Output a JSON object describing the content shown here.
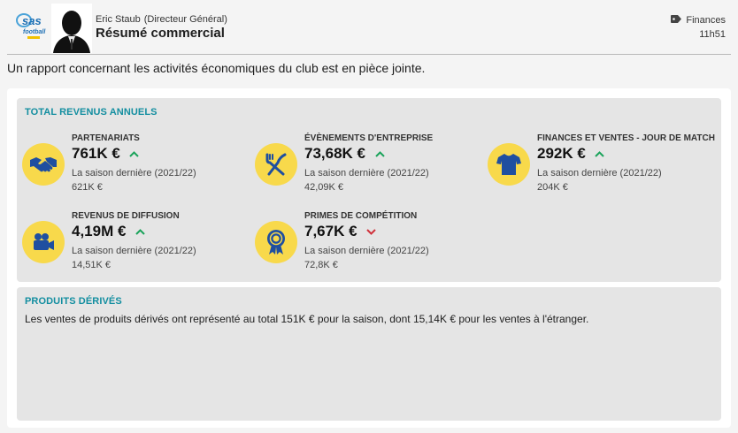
{
  "header": {
    "logo_text": "sas football",
    "sender_name": "Eric Staub",
    "sender_role": "(Directeur Général)",
    "subject": "Résumé commercial",
    "category": "Finances",
    "time": "11h51",
    "category_icon": "tag-icon"
  },
  "intro": "Un rapport concernant les activités économiques du club est en pièce jointe.",
  "revenue": {
    "title": "TOTAL REVENUS ANNUELS",
    "items": [
      {
        "label": "PARTENARIATS",
        "value": "761K €",
        "trend": "up",
        "previous_label": "La saison dernière (2021/22)",
        "previous_value": "621K €",
        "icon": "handshake-icon"
      },
      {
        "label": "ÉVÈNEMENTS D'ENTREPRISE",
        "value": "73,68K €",
        "trend": "up",
        "previous_label": "La saison dernière (2021/22)",
        "previous_value": "42,09K €",
        "icon": "fork-knife-icon"
      },
      {
        "label": "FINANCES ET VENTES - JOUR DE MATCH",
        "value": "292K €",
        "trend": "up",
        "previous_label": "La saison dernière (2021/22)",
        "previous_value": "204K €",
        "icon": "jersey-icon"
      },
      {
        "label": "REVENUS DE DIFFUSION",
        "value": "4,19M €",
        "trend": "up",
        "previous_label": "La saison dernière (2021/22)",
        "previous_value": "14,51K €",
        "icon": "video-camera-icon"
      },
      {
        "label": "PRIMES DE COMPÉTITION",
        "value": "7,67K €",
        "trend": "down",
        "previous_label": "La saison dernière (2021/22)",
        "previous_value": "72,8K €",
        "icon": "medal-icon"
      }
    ]
  },
  "merch": {
    "title": "PRODUITS DÉRIVÉS",
    "text": "Les ventes de produits dérivés ont représenté au total 151K € pour la saison, dont 15,14K € pour les ventes à l'étranger."
  },
  "colors": {
    "accent_teal": "#138ea0",
    "icon_yellow": "#f8d94b",
    "trend_up": "#1aa35a",
    "trend_down": "#d0303a"
  }
}
